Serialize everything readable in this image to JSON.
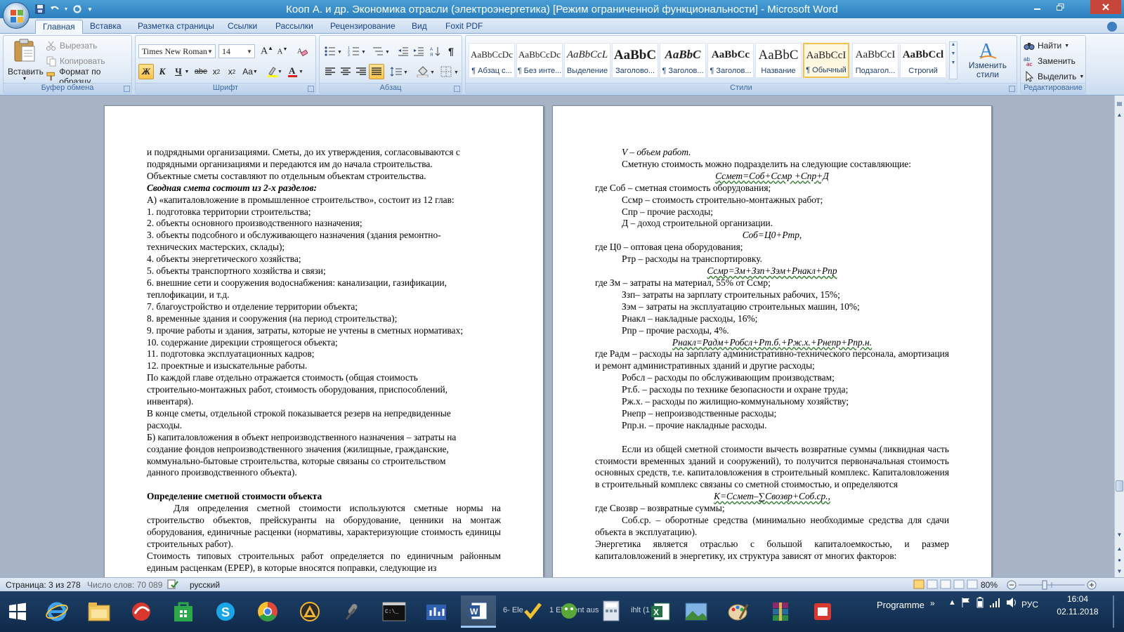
{
  "window": {
    "title": "Кооп А. и др. Экономика отрасли (электроэнергетика) [Режим ограниченной функциональности] - Microsoft Word"
  },
  "tabs": [
    "Главная",
    "Вставка",
    "Разметка страницы",
    "Ссылки",
    "Рассылки",
    "Рецензирование",
    "Вид",
    "Foxit PDF"
  ],
  "ribbon": {
    "clipboard": {
      "label": "Буфер обмена",
      "paste": "Вставить",
      "cut": "Вырезать",
      "copy": "Копировать",
      "format_painter": "Формат по образцу"
    },
    "font": {
      "label": "Шрифт",
      "font_name": "Times New Roman",
      "font_size": "14"
    },
    "paragraph": {
      "label": "Абзац"
    },
    "styles": {
      "label": "Стили",
      "items": [
        {
          "sample": "AaBbCcDc",
          "name": "¶ Абзац с..."
        },
        {
          "sample": "AaBbCcDc",
          "name": "¶ Без инте..."
        },
        {
          "sample": "AaBbCcL",
          "name": "Выделение"
        },
        {
          "sample": "AaBbC",
          "name": "Заголово..."
        },
        {
          "sample": "AaBbC",
          "name": "¶ Заголов..."
        },
        {
          "sample": "AaBbCc",
          "name": "¶ Заголов..."
        },
        {
          "sample": "AaBbC",
          "name": "Название"
        },
        {
          "sample": "AaBbCcI",
          "name": "¶ Обычный"
        },
        {
          "sample": "AaBbCcI",
          "name": "Подзагол..."
        },
        {
          "sample": "AaBbCcl",
          "name": "Строгий"
        }
      ],
      "change_styles": "Изменить стили"
    },
    "editing": {
      "label": "Редактирование",
      "find": "Найти",
      "replace": "Заменить",
      "select": "Выделить"
    }
  },
  "page_left": {
    "lines": [
      "и подрядными организациями. Сметы, до их утверждения, согласовываются с",
      "подрядными организациями и передаются им до начала строительства.",
      "Объектные сметы составляют по отдельным объектам строительства.",
      "Сводная смета состоит из 2-х разделов:",
      "А) «капиталовложение в промышленное строительство», состоит из 12 глав:",
      "1. подготовка территории строительства;",
      "2. объекты основного производственного назначения;",
      "3. объекты подсобного и обслуживающего назначения (здания ремонтно-",
      "технических мастерских, склады);",
      "4. объекты энергетического хозяйства;",
      "5. объекты транспортного хозяйства и связи;",
      "6. внешние сети и сооружения водоснабжения: канализации, газификации,",
      "теплофикации, и т.д.",
      "7. благоустройство и отделение территории объекта;",
      "8. временные здания и сооружения (на период строительства);",
      "9. прочие работы и здания, затраты, которые не учтены в сметных нормативах;",
      "10. содержание дирекции строящегося объекта;",
      "11. подготовка эксплуатационных кадров;",
      "12. проектные и изыскательные работы.",
      "По каждой главе отдельно отражается стоимость (общая стоимость",
      "строительно-монтажных работ, стоимость оборудования, приспособлений,",
      "инвентаря).",
      "В конце сметы, отдельной строкой показывается резерв на непредвиденные",
      "расходы.",
      "Б) капиталовложения в объект непроизводственного назначения – затраты на",
      "создание фондов непроизводственного значения (жилищные, гражданские,",
      "коммунально-бытовые строительства, которые связаны со строительством",
      "данного производственного объекта).",
      "Определение сметной стоимости объекта",
      "Для определения сметной стоимости используются сметные нормы на строительство объектов, прейскуранты на оборудование, ценники на монтаж оборудования, единичные расценки (нормативы, характеризующие стоимость единицы строительных работ).",
      "Стоимость типовых строительных работ определяется по единичным районным единым расценкам (ЕРЕР), в которые вносятся поправки, следующие из"
    ]
  },
  "page_right": {
    "lines": [
      "V – объем работ.",
      "Сметную стоимость можно подразделить на следующие составляющие:",
      "Cсмет=Cоб+Cсмр +Cпр+Д",
      "где Cоб – сметная стоимость оборудования;",
      "Cсмр – стоимость строительно-монтажных работ;",
      "Cпр – прочие расходы;",
      "Д – доход строительной организации.",
      "Cоб=Ц0+Ртр,",
      "где Ц0 – оптовая цена оборудования;",
      "Ртр – расходы на транспортировку.",
      "Cсмр=Зм+Ззп+Зэм+Рнакл+Рпр",
      "где Зм – затраты на материал, 55% от Cсмр;",
      "Ззп– затраты на зарплату строительных рабочих, 15%;",
      "Зэм – затраты на эксплуатацию строительных машин, 10%;",
      "Рнакл – накладные расходы, 16%;",
      "Рпр – прочие расходы, 4%.",
      "Рнакл=Радм+Робсл+Рт.б.+Рж.х.+Рнепр+Рпр.н.",
      "где Радм – расходы на зарплату административно-технического персонала, амортизация и ремонт административных зданий и другие расходы;",
      "Робсл – расходы по обслуживающим производствам;",
      "Рт.б. – расходы по технике безопасности и охране труда;",
      "Рж.х. – расходы по жилищно-коммунальному хозяйству;",
      "Рнепр – непроизводственные расходы;",
      "Рпр.н. – прочие накладные расходы.",
      "Если из общей сметной стоимости вычесть возвратные суммы (ликвидная часть стоимости временных зданий и сооружений), то получится первоначальная стоимость основных средств, т.е. капиталовложения в строительный комплекс. Капиталовложения в строительный комплекс связаны со сметной стоимостью, и определяются",
      "К=Cсмет–∑Cвозвр+Cоб.ср.,",
      "где Cвозвр – возвратные суммы;",
      "Cоб.ср. – оборотные средства (минимально необходимые средства для сдачи объекта в эксплуатацию).",
      "Энергетика является отраслью с большой капиталоемкостью, и размер капиталовложений в энергетику, их структура зависят от многих факторов:"
    ]
  },
  "statusbar": {
    "page": "Страница: 3 из 278",
    "words": "Число слов: 70 089",
    "language": "русский",
    "zoom": "80%"
  },
  "taskbar": {
    "partial_labels": [
      "6- Ele",
      "1 Element aus",
      "ihlt (1"
    ],
    "programme": "Programme",
    "lang": "РУС",
    "time": "16:04",
    "date": "02.11.2018"
  }
}
